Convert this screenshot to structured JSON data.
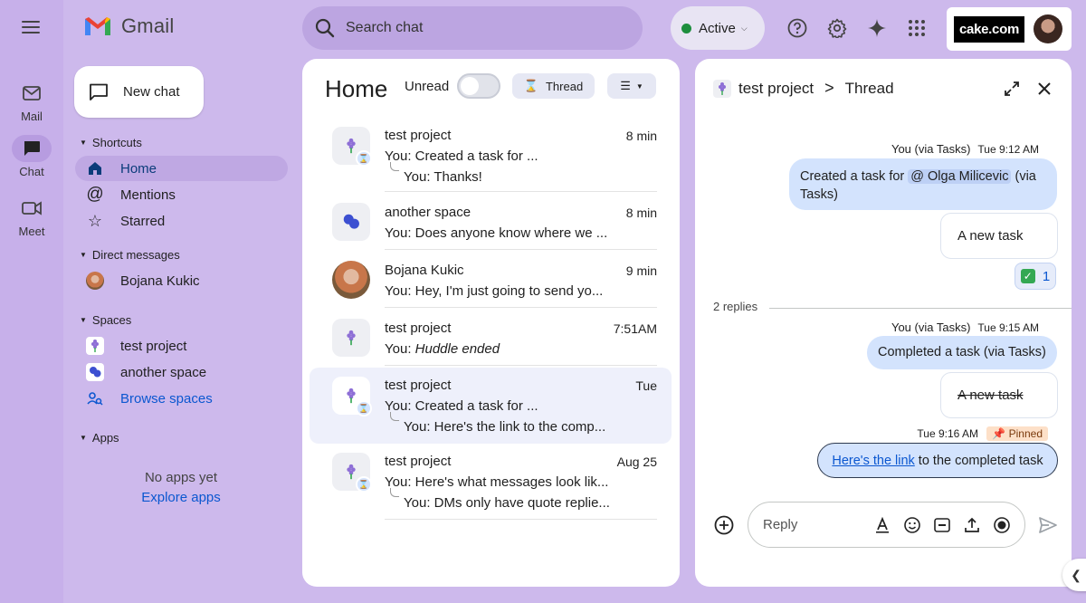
{
  "app": {
    "logo_text": "Gmail"
  },
  "rail": {
    "items": [
      {
        "label": "Mail",
        "icon": "mail-icon"
      },
      {
        "label": "Chat",
        "icon": "chat-icon",
        "active": true
      },
      {
        "label": "Meet",
        "icon": "video-icon"
      }
    ]
  },
  "search": {
    "placeholder": "Search chat"
  },
  "status": {
    "label": "Active",
    "color": "#1e8e3e"
  },
  "account": {
    "brand": "cake.com"
  },
  "sidebar": {
    "new_chat": "New chat",
    "shortcuts_header": "Shortcuts",
    "shortcuts": [
      "Home",
      "Mentions",
      "Starred"
    ],
    "dm_header": "Direct messages",
    "dms": [
      "Bojana Kukic"
    ],
    "spaces_header": "Spaces",
    "spaces": [
      "test project",
      "another space"
    ],
    "browse_spaces": "Browse spaces",
    "apps_header": "Apps",
    "no_apps": "No apps yet",
    "explore_apps": "Explore apps"
  },
  "home": {
    "title": "Home",
    "unread_label": "Unread",
    "thread_chip": "Thread",
    "conversations": [
      {
        "name": "test project",
        "time": "8 min",
        "preview": "You: Created a task for ...",
        "reply": "You: Thanks!"
      },
      {
        "name": "another space",
        "time": "8 min",
        "preview": "You: Does anyone know where we ..."
      },
      {
        "name": "Bojana Kukic",
        "time": "9 min",
        "preview": "You: Hey, I'm just going to send yo..."
      },
      {
        "name": "test project",
        "time": "7:51AM",
        "preview_prefix": "You: ",
        "preview_italic": "Huddle ended"
      },
      {
        "name": "test project",
        "time": "Tue",
        "preview": "You: Created a task for ...",
        "reply": "You: Here's the link to the comp..."
      },
      {
        "name": "test project",
        "time": "Aug 25",
        "preview": "You: Here's what messages look lik...",
        "reply": "You: DMs only have quote replie..."
      }
    ]
  },
  "thread": {
    "space_name": "test project",
    "separator": ">",
    "label": "Thread",
    "messages": {
      "m1_sender": "You (via Tasks)",
      "m1_time": "Tue 9:12 AM",
      "m1_text_before": "Created a task for",
      "m1_mention": "@ Olga Milicevic",
      "m1_text_after": "(via",
      "m1_text_line2": "Tasks)",
      "task1": "A new task",
      "reaction_count": "1",
      "replies": "2 replies",
      "m2_sender": "You (via Tasks)",
      "m2_time": "Tue 9:15 AM",
      "m2_text": "Completed a task (via Tasks)",
      "task2": "A new task",
      "m3_time": "Tue 9:16 AM",
      "pinned_label": "Pinned",
      "m3_link": "Here's the link",
      "m3_text": "to the completed task"
    },
    "reply_placeholder": "Reply"
  }
}
